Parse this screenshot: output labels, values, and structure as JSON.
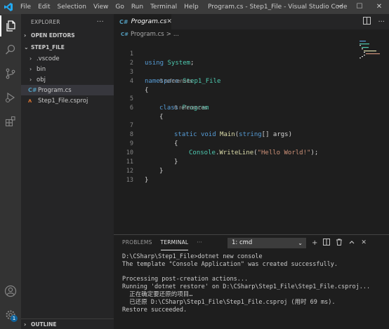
{
  "titlebar": {
    "menu": [
      "File",
      "Edit",
      "Selection",
      "View",
      "Go",
      "Run",
      "Terminal",
      "Help"
    ],
    "window_title": "Program.cs - Step1_File - Visual Studio Code",
    "minimize": "─",
    "maximize": "☐",
    "close": "✕"
  },
  "activity": {
    "badge": "1",
    "icons": [
      "explorer-icon",
      "search-icon",
      "source-control-icon",
      "run-debug-icon",
      "extensions-icon",
      "account-icon",
      "settings-gear-icon"
    ]
  },
  "sidebar": {
    "header": "EXPLORER",
    "more": "···",
    "open_editors": "OPEN EDITORS",
    "folder": "STEP1_FILE",
    "items": [
      {
        "label": ".vscode",
        "kind": "folder"
      },
      {
        "label": "bin",
        "kind": "folder"
      },
      {
        "label": "obj",
        "kind": "folder"
      },
      {
        "label": "Program.cs",
        "kind": "cs-file"
      },
      {
        "label": "Step1_File.csproj",
        "kind": "rss-file"
      }
    ],
    "outline": "OUTLINE"
  },
  "editor": {
    "tab_label": "Program.cs",
    "tab_icon": "C#",
    "breadcrumb_file": "Program.cs",
    "breadcrumb_sep": ">",
    "breadcrumb_more": "...",
    "references": "0 references",
    "line_numbers": [
      "1",
      "2",
      "3",
      "4",
      "5",
      "6",
      "7",
      "8",
      "9",
      "10",
      "11",
      "12",
      "13"
    ]
  },
  "panel": {
    "tabs": [
      "PROBLEMS",
      "TERMINAL",
      "···"
    ],
    "active_tab": "TERMINAL",
    "terminal_select": "1: cmd",
    "terminal_lines": [
      "D:\\CSharp\\Step1_File>dotnet new console",
      "The template \"Console Application\" was created successfully.",
      "",
      "Processing post-creation actions...",
      "Running 'dotnet restore' on D:\\CSharp\\Step1_File\\Step1_File.csproj...",
      "  正在确定要还原的项目…",
      "  已还原 D:\\CSharp\\Step1_File\\Step1_File.csproj (用时 69 ms).",
      "Restore succeeded."
    ]
  },
  "colors": {
    "keyword": "#569cd6",
    "type": "#4ec9b0",
    "function": "#dcdcaa",
    "string": "#ce9178",
    "accent": "#007acc"
  }
}
